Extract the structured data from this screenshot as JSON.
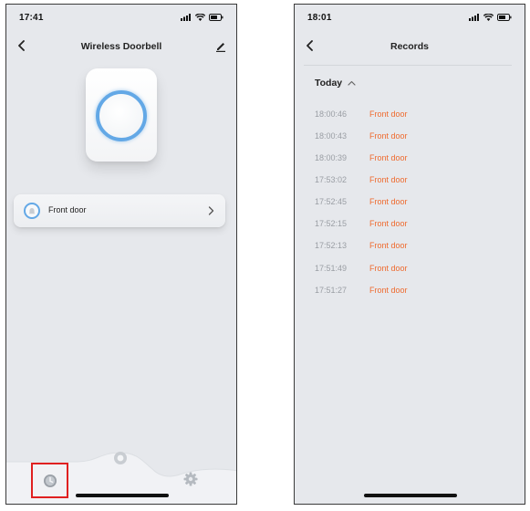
{
  "left_screen": {
    "status": {
      "time": "17:41"
    },
    "nav": {
      "title": "Wireless Doorbell"
    },
    "device": {
      "ring_color": "#63a8e6"
    },
    "door": {
      "label": "Front door"
    },
    "tabs": [
      "history-icon",
      "home-button-icon",
      "settings-icon"
    ],
    "highlight_color": "#e02020"
  },
  "right_screen": {
    "status": {
      "time": "18:01"
    },
    "nav": {
      "title": "Records"
    },
    "section": {
      "label": "Today"
    },
    "records": [
      {
        "time": "18:00:46",
        "place": "Front door"
      },
      {
        "time": "18:00:43",
        "place": "Front door"
      },
      {
        "time": "18:00:39",
        "place": "Front door"
      },
      {
        "time": "17:53:02",
        "place": "Front door"
      },
      {
        "time": "17:52:45",
        "place": "Front door"
      },
      {
        "time": "17:52:15",
        "place": "Front door"
      },
      {
        "time": "17:52:13",
        "place": "Front door"
      },
      {
        "time": "17:51:49",
        "place": "Front door"
      },
      {
        "time": "17:51:27",
        "place": "Front door"
      }
    ],
    "accent_color": "#ef6a2e"
  }
}
